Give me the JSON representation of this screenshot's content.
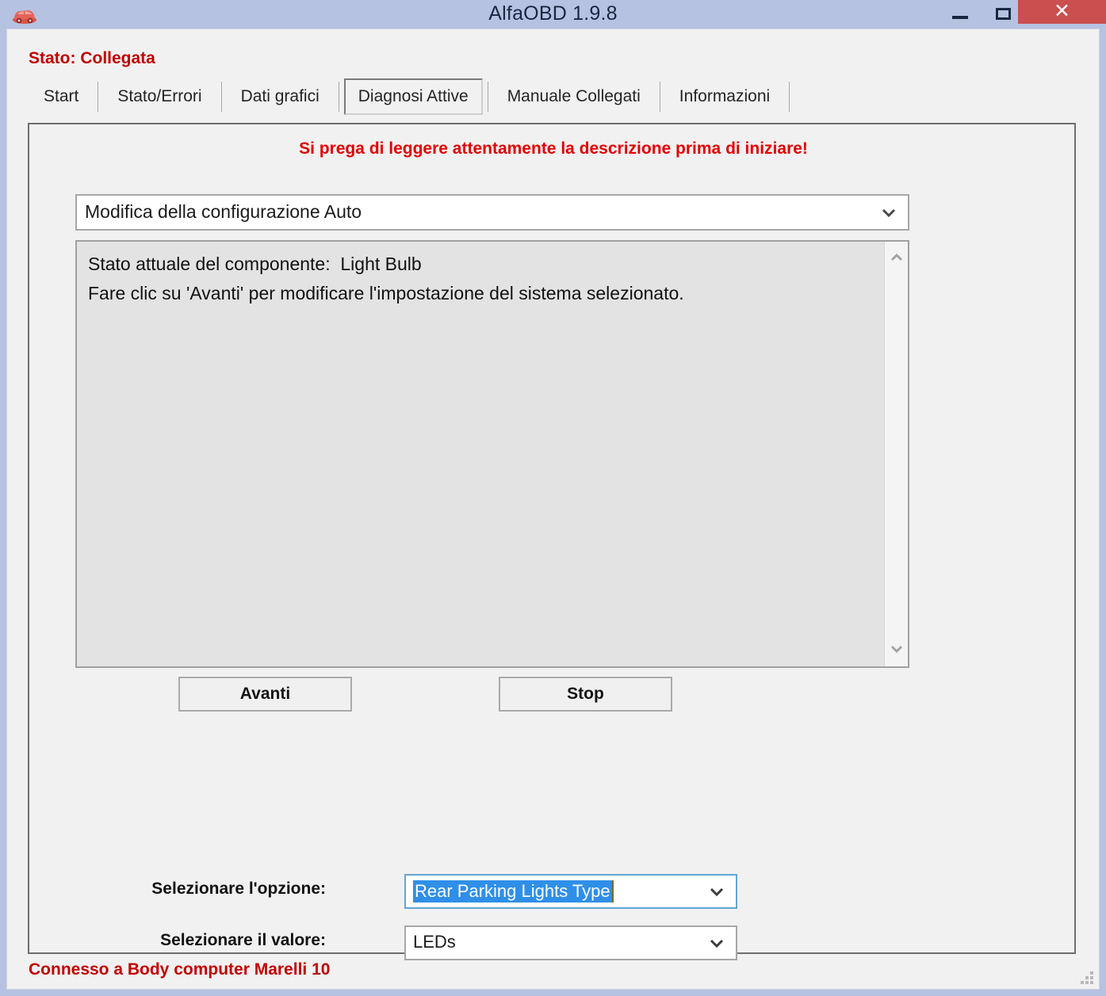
{
  "window": {
    "title": "AlfaOBD 1.9.8",
    "icon": "car-icon",
    "minimize_label": "–",
    "maximize_label": "□",
    "close_label": "✕",
    "accent_close": "#cb4f4f",
    "titlebar_color": "#b6c2e2"
  },
  "status": {
    "top": "Stato: Collegata",
    "bottom": "Connesso a Body computer Marelli 10",
    "color": "#c00000"
  },
  "tabs": [
    {
      "label": "Start",
      "selected": false
    },
    {
      "label": "Stato/Errori",
      "selected": false
    },
    {
      "label": "Dati grafici",
      "selected": false
    },
    {
      "label": "Diagnosi Attive",
      "selected": true
    },
    {
      "label": "Manuale Collegati",
      "selected": false
    },
    {
      "label": "Informazioni",
      "selected": false
    }
  ],
  "panel": {
    "warning": "Si prega di leggere attentamente la descrizione prima di iniziare!",
    "warning_color": "#e00000",
    "function_combo": {
      "value": "Modifica della configurazione Auto",
      "chevron": "chevron-down-icon"
    },
    "description": "Stato attuale del componente:  Light Bulb\nFare clic su 'Avanti' per modificare l'impostazione del sistema selezionato.",
    "scrollbar": {
      "up": "˄",
      "down": "˅"
    },
    "buttons": {
      "next": "Avanti",
      "stop": "Stop"
    },
    "option_row": {
      "label": "Selezionare l'opzione:",
      "value": "Rear Parking Lights Type",
      "selected": true,
      "selection_color": "#2f8fe8"
    },
    "value_row": {
      "label": "Selezionare il valore:",
      "value": "LEDs"
    }
  }
}
